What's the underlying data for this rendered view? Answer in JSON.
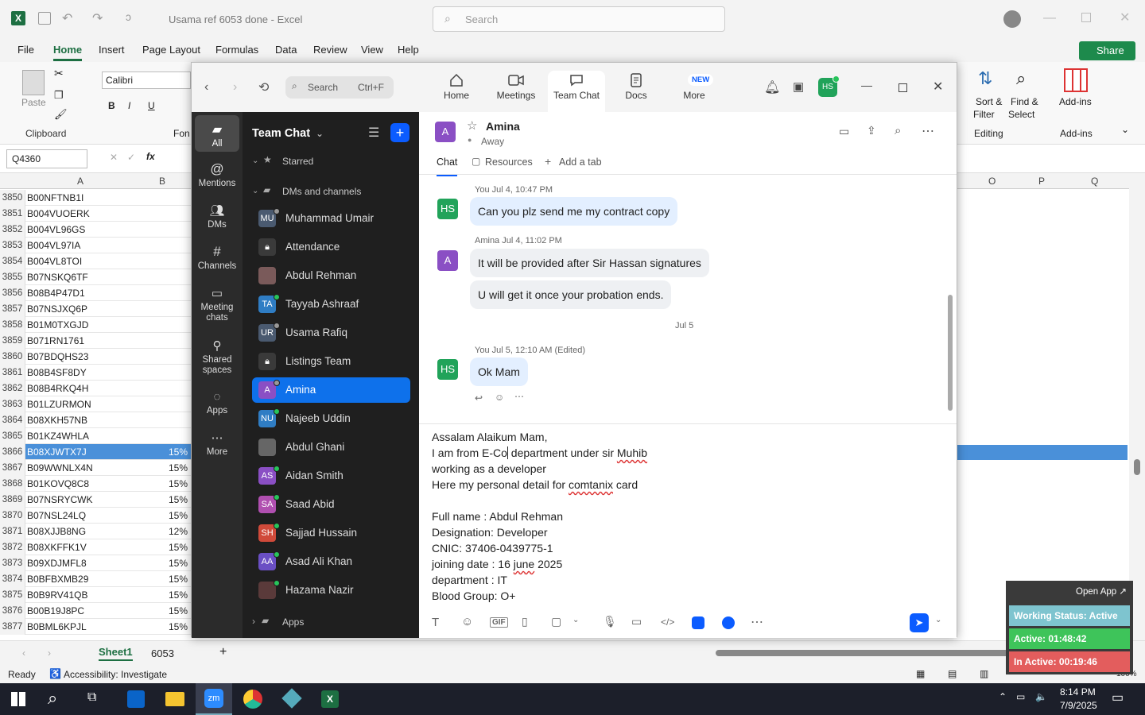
{
  "excel": {
    "title": "Usama ref 6053 done  -  Excel",
    "search_placeholder": "Search",
    "share_label": "Share",
    "menu": [
      "File",
      "Home",
      "Insert",
      "Page Layout",
      "Formulas",
      "Data",
      "Review",
      "View",
      "Help"
    ],
    "font_name": "Calibri",
    "clipboard_label": "Clipboard",
    "paste_label": "Paste",
    "font_group_label": "Fon",
    "sort_filter_label": "Sort &",
    "sort_filter_label2": "Filter",
    "find_select_label": "Find &",
    "find_select_label2": "Select",
    "editing_label": "Editing",
    "addins_label": "Add-ins",
    "addins_group": "Add-ins",
    "name_box": "Q4360",
    "col_headers": [
      "A",
      "B",
      "O",
      "P",
      "Q"
    ],
    "rows": [
      {
        "n": "3850",
        "a": "B00NFTNB1I",
        "b": ""
      },
      {
        "n": "3851",
        "a": "B004VUOERK",
        "b": ""
      },
      {
        "n": "3852",
        "a": "B004VL96GS",
        "b": ""
      },
      {
        "n": "3853",
        "a": "B004VL97IA",
        "b": ""
      },
      {
        "n": "3854",
        "a": "B004VL8TOI",
        "b": ""
      },
      {
        "n": "3855",
        "a": "B07NSKQ6TF",
        "b": ""
      },
      {
        "n": "3856",
        "a": "B08B4P47D1",
        "b": ""
      },
      {
        "n": "3857",
        "a": "B07NSJXQ6P",
        "b": ""
      },
      {
        "n": "3858",
        "a": "B01M0TXGJD",
        "b": ""
      },
      {
        "n": "3859",
        "a": "B071RN1761",
        "b": ""
      },
      {
        "n": "3860",
        "a": "B07BDQHS23",
        "b": ""
      },
      {
        "n": "3861",
        "a": "B08B4SF8DY",
        "b": ""
      },
      {
        "n": "3862",
        "a": "B08B4RKQ4H",
        "b": ""
      },
      {
        "n": "3863",
        "a": "B01LZURMON",
        "b": ""
      },
      {
        "n": "3864",
        "a": "B08XKH57NB",
        "b": ""
      },
      {
        "n": "3865",
        "a": "B01KZ4WHLA",
        "b": ""
      },
      {
        "n": "3866",
        "a": "B08XJWTX7J",
        "b": "15%"
      },
      {
        "n": "3867",
        "a": "B09WWNLX4N",
        "b": "15%"
      },
      {
        "n": "3868",
        "a": "B01KOVQ8C8",
        "b": "15%"
      },
      {
        "n": "3869",
        "a": "B07NSRYCWK",
        "b": "15%"
      },
      {
        "n": "3870",
        "a": "B07NSL24LQ",
        "b": "15%"
      },
      {
        "n": "3871",
        "a": "B08XJJB8NG",
        "b": "12%"
      },
      {
        "n": "3872",
        "a": "B08XKFFK1V",
        "b": "15%"
      },
      {
        "n": "3873",
        "a": "B09XDJMFL8",
        "b": "15%"
      },
      {
        "n": "3874",
        "a": "B0BFBXMB29",
        "b": "15%"
      },
      {
        "n": "3875",
        "a": "B0B9RV41QB",
        "b": "15%"
      },
      {
        "n": "3876",
        "a": "B00B19J8PC",
        "b": "15%"
      },
      {
        "n": "3877",
        "a": "B0BML6KPJL",
        "b": "15%"
      }
    ],
    "sheet_tabs": [
      "Sheet1",
      "6053"
    ],
    "status_ready": "Ready",
    "status_accessibility": "Accessibility: Investigate",
    "zoom_pct": "100%"
  },
  "zoom": {
    "search_label": "Search",
    "search_shortcut": "Ctrl+F",
    "tabs": [
      "Home",
      "Meetings",
      "Team Chat",
      "Docs",
      "More"
    ],
    "new_badge": "NEW",
    "user_initials": "HS",
    "rail": [
      "All",
      "Mentions",
      "DMs",
      "Channels",
      "Meeting chats",
      "Shared spaces",
      "Apps",
      "More"
    ],
    "list_title": "Team Chat",
    "starred": "Starred",
    "dms_header": "DMs and channels",
    "apps_section": "Apps",
    "contacts": [
      {
        "initials": "MU",
        "name": "Muhammad Umair",
        "color": "#4a5a70"
      },
      {
        "initials": "",
        "name": "Attendance",
        "color": "#3a3a3a"
      },
      {
        "initials": "",
        "name": "Abdul Rehman",
        "color": "#7a5a5a"
      },
      {
        "initials": "TA",
        "name": "Tayyab Ashraaf",
        "color": "#2f7dc4"
      },
      {
        "initials": "UR",
        "name": "Usama Rafiq",
        "color": "#4a5a70"
      },
      {
        "initials": "",
        "name": "Listings Team",
        "color": "#3a3a3a"
      },
      {
        "initials": "A",
        "name": "Amina",
        "color": "#8a4fc4"
      },
      {
        "initials": "NU",
        "name": "Najeeb Uddin",
        "color": "#2f7dc4"
      },
      {
        "initials": "",
        "name": "Abdul Ghani",
        "color": "#666"
      },
      {
        "initials": "AS",
        "name": "Aidan Smith",
        "color": "#8a4fc4"
      },
      {
        "initials": "SA",
        "name": "Saad Abid",
        "color": "#b04fb0"
      },
      {
        "initials": "SH",
        "name": "Sajjad Hussain",
        "color": "#d04a3a"
      },
      {
        "initials": "AA",
        "name": "Asad Ali Khan",
        "color": "#6a4fc4"
      },
      {
        "initials": "",
        "name": "Hazama Nazir",
        "color": "#5a3a3a"
      }
    ],
    "chat": {
      "name": "Amina",
      "status": "Away",
      "tab_chat": "Chat",
      "tab_resources": "Resources",
      "tab_add": "Add a tab",
      "m1_meta": "You Jul 4, 10:47 PM",
      "m1_text": "Can you plz send me my contract copy",
      "m2_meta": "Amina Jul 4, 11:02 PM",
      "m2_text": "It will be provided after Sir Hassan signatures",
      "m3_text": "U will get it once your probation ends.",
      "date_sep": "Jul 5",
      "m4_meta": "You Jul 5, 12:10 AM (Edited)",
      "m4_text": "Ok Mam",
      "composer": {
        "l1": "Assalam Alaikum Mam,",
        "l2a": "I am from E-Co",
        "l2b": " department under sir ",
        "l2c": "Muhib",
        "l3": "working as a developer",
        "l4a": "Here my personal  detail for ",
        "l4b": "comtanix",
        "l4c": "  card",
        "l5": "Full name : Abdul Rehman",
        "l6": "Designation: Developer",
        "l7": "CNIC:  37406-0439775-1",
        "l8a": "joining date : 16 ",
        "l8b": "june",
        "l8c": " 2025",
        "l9": "department : IT",
        "l10": "Blood Group: O+"
      },
      "gif_label": "GIF"
    }
  },
  "widget": {
    "open_app": "Open App ↗",
    "working": "Working Status: Active",
    "active": "Active: 01:48:42",
    "inactive": "In Active: 00:19:46"
  },
  "taskbar": {
    "time": "8:14 PM",
    "date": "7/9/2025"
  }
}
